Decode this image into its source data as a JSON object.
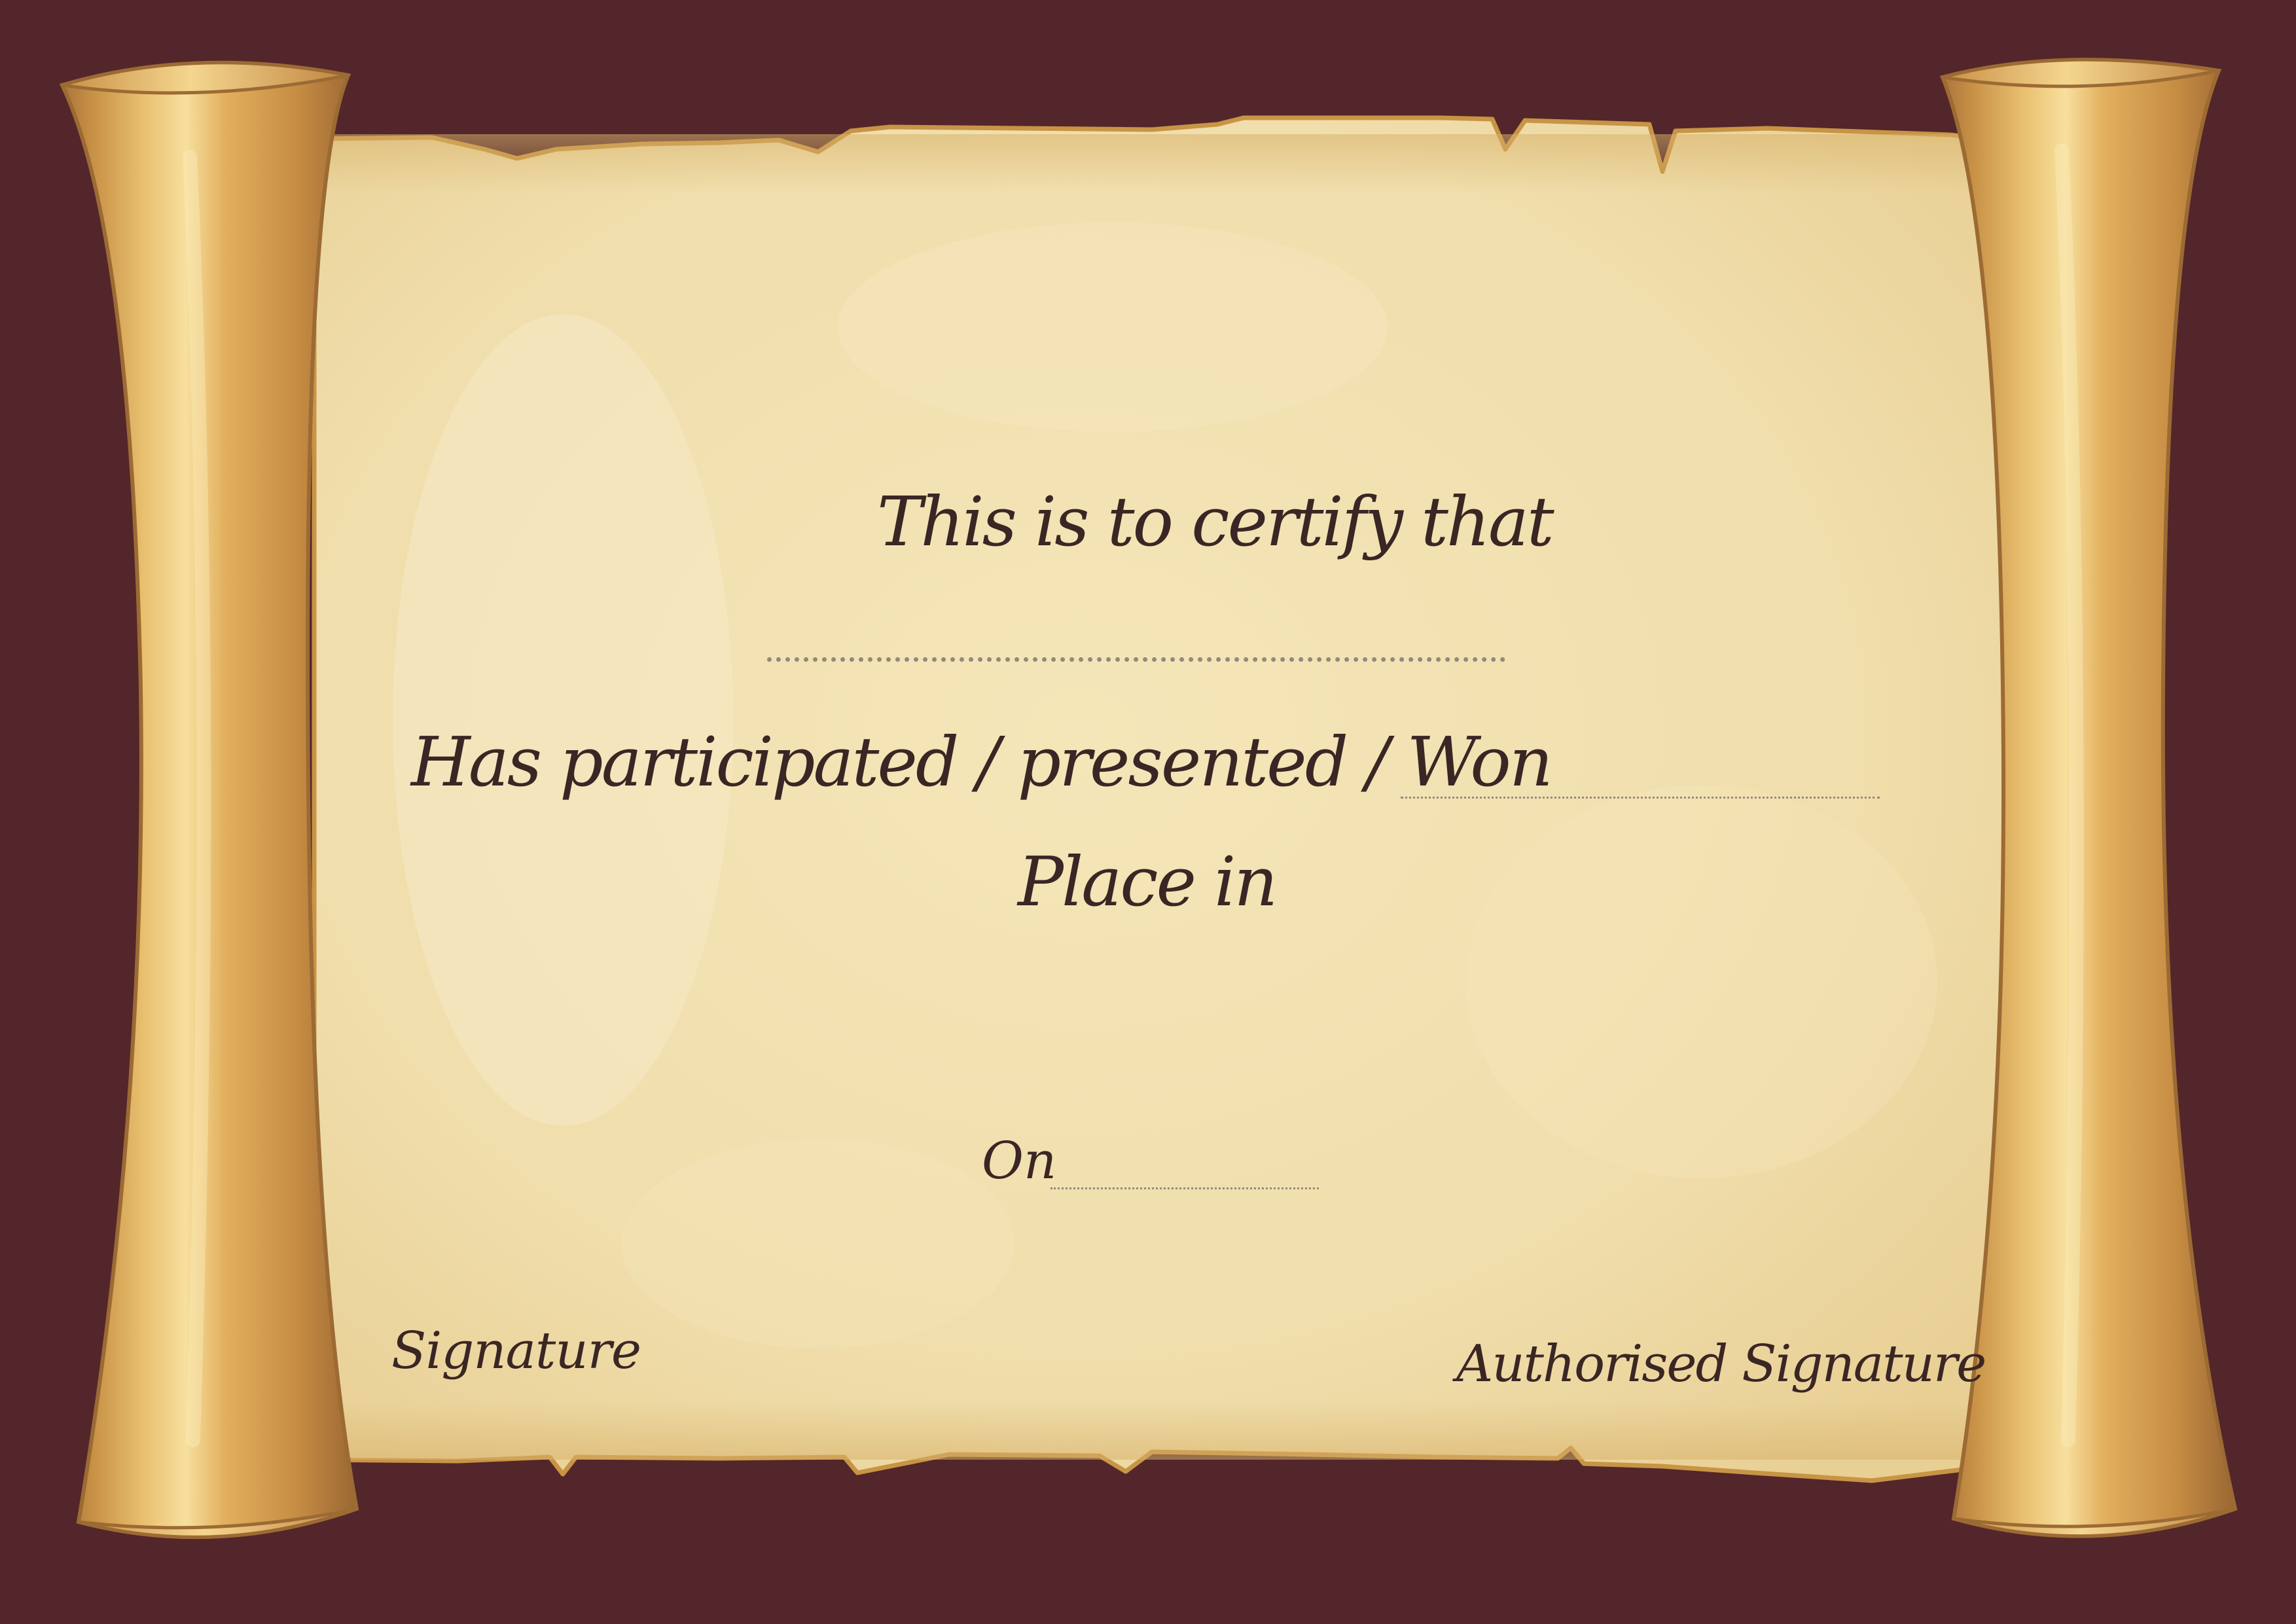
{
  "certificate": {
    "heading": "This is to certify that",
    "participation": "Has participated / presented / Won",
    "place": "Place in",
    "date_prefix": "On",
    "signature_left": "Signature",
    "signature_right": "Authorised Signature"
  },
  "colors": {
    "background": "#52262a",
    "parchment": "#f2e2b2",
    "roller_gold": "#d9a955",
    "text": "#3a2624"
  }
}
